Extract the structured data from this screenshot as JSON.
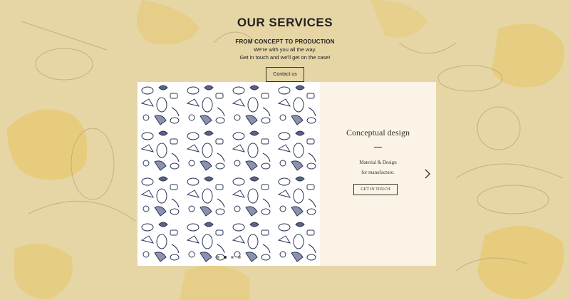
{
  "header": {
    "title": "OUR SERVICES",
    "kicker": "FROM CONCEPT TO PRODUCTION",
    "line1": "We're with you all the way.",
    "line2": "Get in touch and we'll get on the case!",
    "contact_label": "Contact us"
  },
  "slide": {
    "title": "Conceptual design",
    "desc_line1": "Material & Design",
    "desc_line2": "for manufacture.",
    "button_label": "GET IN TOUCH"
  },
  "slider": {
    "dot_count": 4,
    "active_index": 1
  },
  "icons": {
    "next": "chevron-right-icon"
  },
  "colors": {
    "background": "#e6d6a6",
    "panel": "#fbf3e6",
    "pattern_bg": "#ffffff",
    "sketch_ink": "#2b3557",
    "accent_yellow": "#e8c24a"
  }
}
